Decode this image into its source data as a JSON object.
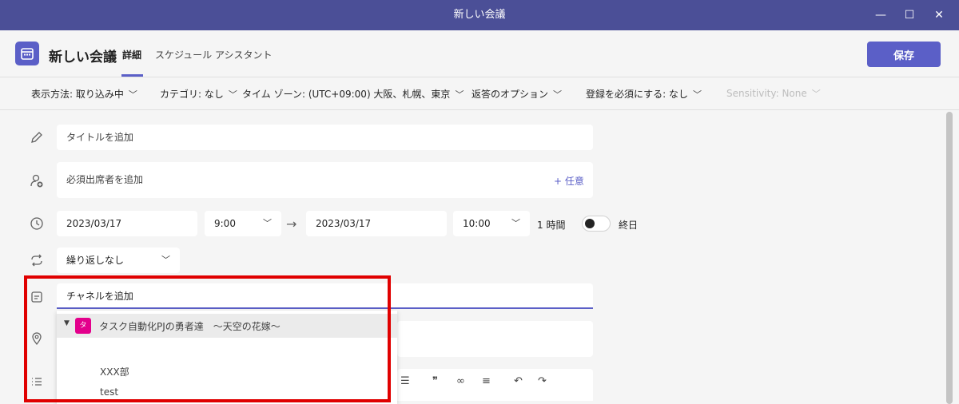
{
  "window": {
    "title": "新しい会議",
    "minimize": "—",
    "maximize": "☐",
    "close": "✕"
  },
  "header": {
    "title": "新しい会議",
    "tab_details": "詳細",
    "tab_schedule": "スケジュール アシスタント",
    "save_label": "保存"
  },
  "options": {
    "display": "表示方法: 取り込み中",
    "category": "カテゴリ: なし",
    "timezone": "タイム ゾーン: (UTC+09:00) 大阪、札幌、東京",
    "response": "返答のオプション",
    "registration": "登録を必須にする: なし",
    "sensitivity": "Sensitivity: None"
  },
  "form": {
    "title_placeholder": "タイトルを追加",
    "attendees_placeholder": "必須出席者を追加",
    "optional_label": "+ 任意",
    "start_date": "2023/03/17",
    "start_time": "9:00",
    "end_date": "2023/03/17",
    "end_time": "10:00",
    "duration": "1 時間",
    "all_day": "終日",
    "repeat": "繰り返しなし",
    "channel_placeholder": "チャネルを追加"
  },
  "dropdown": {
    "team_badge": "タ",
    "team_name": "タスク自動化PJの勇者達　～天空の花嫁～",
    "channels": [
      "XXX部",
      "test"
    ]
  },
  "colors": {
    "titlebar": "#4b4f97",
    "accent": "#5b5fc7",
    "team_badge": "#e3008c",
    "highlight_box": "#e00000"
  }
}
